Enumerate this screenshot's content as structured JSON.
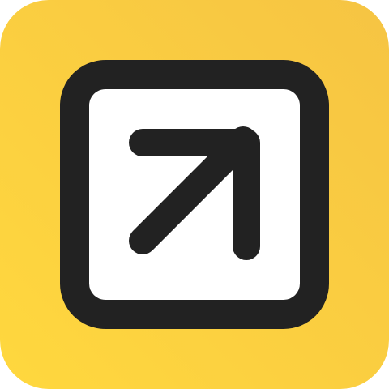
{
  "icon": {
    "name": "open-external-arrow-icon",
    "colors": {
      "background_light": "#FFD83E",
      "background_dark": "#F6C443",
      "frame": "#222222",
      "inner": "#FFFFFF",
      "arrow": "#222222"
    }
  }
}
